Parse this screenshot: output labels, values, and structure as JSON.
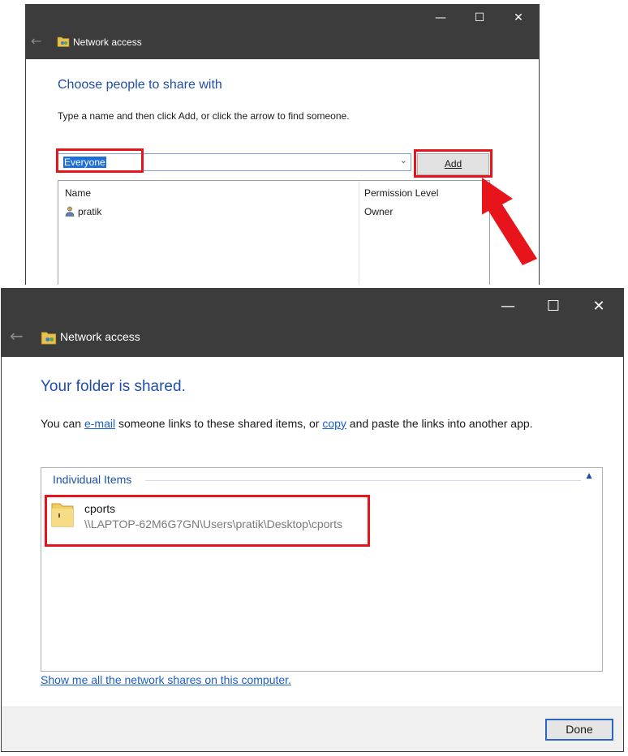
{
  "window1": {
    "title": "Network access",
    "heading": "Choose people to share with",
    "instruction": "Type a name and then click Add, or click the arrow to find someone.",
    "combo_value": "Everyone",
    "add_label": "Add",
    "columns": [
      "Name",
      "Permission Level"
    ],
    "rows": [
      {
        "name": "pratik",
        "permission": "Owner"
      }
    ],
    "icons": [
      "back-arrow-icon",
      "network-folder-icon",
      "minimize-icon",
      "maximize-icon",
      "close-icon",
      "dropdown-arrow-icon",
      "user-icon",
      "red-arrow-icon"
    ]
  },
  "window2": {
    "title": "Network access",
    "heading": "Your folder is shared.",
    "message": {
      "part1": "You can ",
      "email_link": "e-mail",
      "part2": " someone links to these shared items, or ",
      "copy_link": "copy",
      "part3": " and paste the links into another app."
    },
    "group_label": "Individual Items",
    "item": {
      "name": "cports",
      "path": "\\\\LAPTOP-62M6G7GN\\Users\\pratik\\Desktop\\cports"
    },
    "show_link": "Show me all the network shares on this computer.",
    "done_label": "Done",
    "icons": [
      "back-arrow-icon",
      "network-folder-icon",
      "minimize-icon",
      "maximize-icon",
      "close-icon",
      "collapse-caret-icon",
      "folder-icon"
    ]
  },
  "colors": {
    "titlebar": "#3c3c3c",
    "heading": "#1f4fa8",
    "link": "#1a5fc8",
    "highlight": "#e8141c",
    "selection": "#1f6fd8"
  }
}
